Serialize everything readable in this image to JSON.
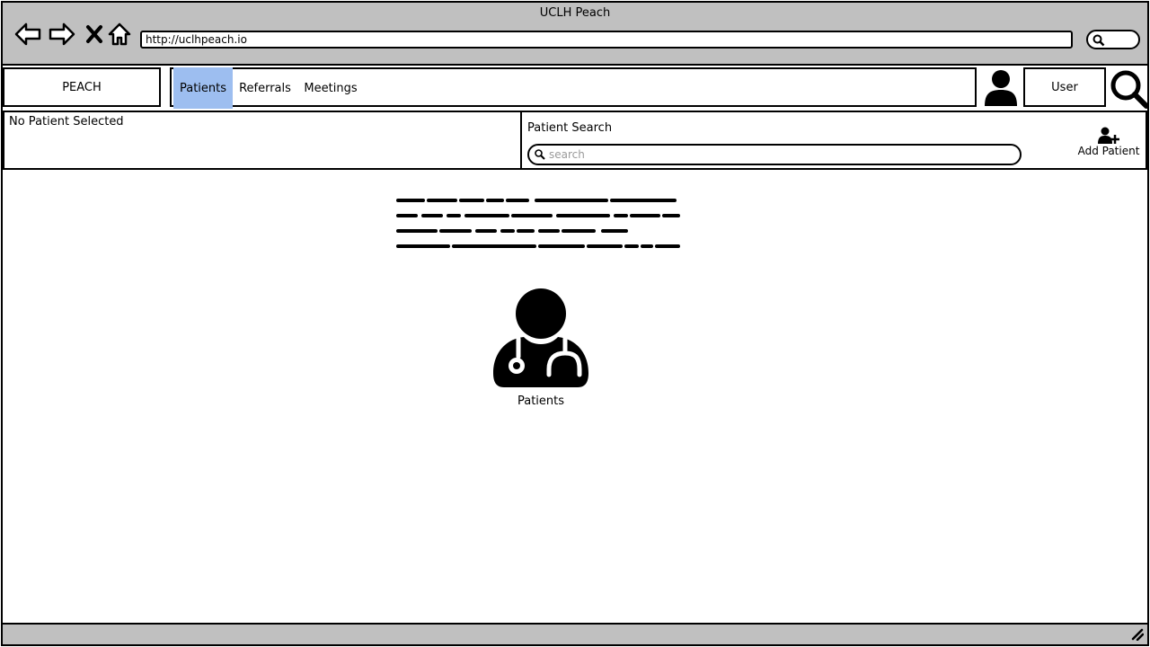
{
  "window": {
    "title": "UCLH Peach"
  },
  "browser": {
    "url": "http://uclhpeach.io",
    "nav": [
      "back-arrow-icon",
      "forward-arrow-icon",
      "close-x-icon",
      "home-icon"
    ]
  },
  "header": {
    "brand": "PEACH",
    "tabs": [
      {
        "label": "Patients",
        "active": true
      },
      {
        "label": "Referrals",
        "active": false
      },
      {
        "label": "Meetings",
        "active": false
      }
    ],
    "user_label": "User"
  },
  "patient_bar": {
    "status": "No Patient Selected",
    "search_label": "Patient Search",
    "search_placeholder": "search",
    "search_value": "",
    "add_patient_label": "Add Patient"
  },
  "main": {
    "feature_label": "Patients",
    "feature_icon": "doctor-stethoscope-icon"
  },
  "colors": {
    "chrome": "#c0c0c0",
    "active_tab": "#9dbef0"
  }
}
